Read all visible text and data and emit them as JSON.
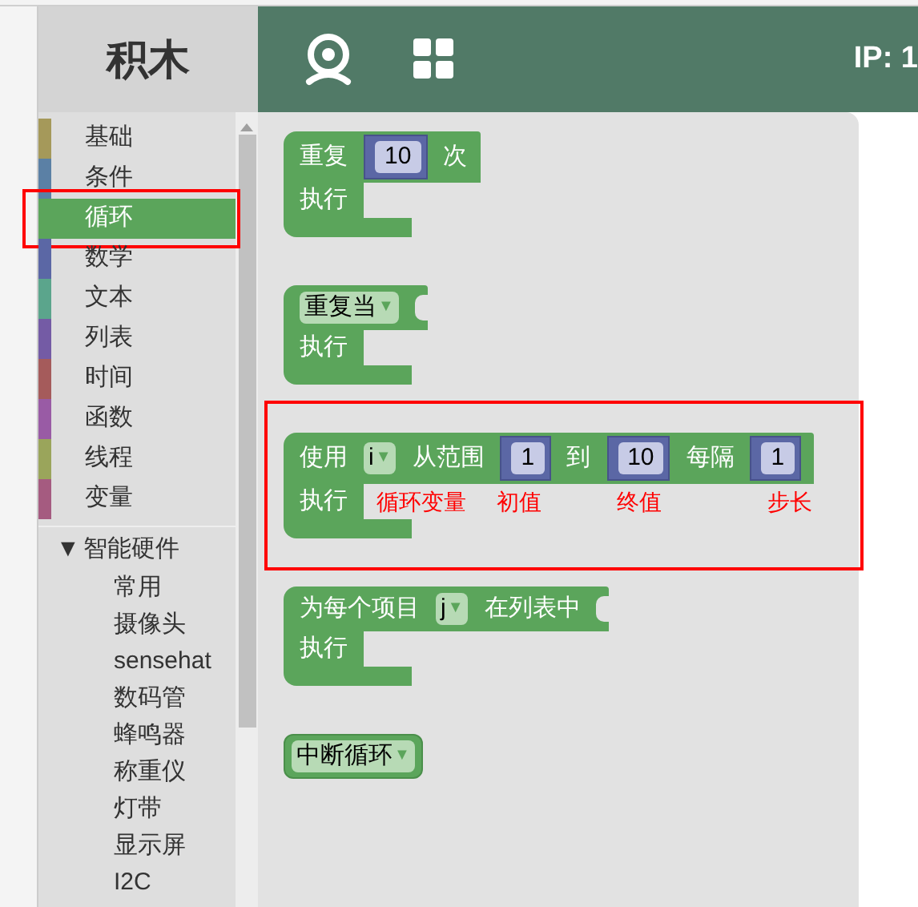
{
  "header": {
    "title": "积木",
    "ip": "IP: 1"
  },
  "categories": [
    {
      "label": "基础",
      "color": "#a5995a",
      "selected": false
    },
    {
      "label": "条件",
      "color": "#5b80a5",
      "selected": false
    },
    {
      "label": "循环",
      "color": "#5ba55b",
      "selected": true,
      "highlighted": true
    },
    {
      "label": "数学",
      "color": "#5b67a5",
      "selected": false
    },
    {
      "label": "文本",
      "color": "#5ba58c",
      "selected": false
    },
    {
      "label": "列表",
      "color": "#745ba5",
      "selected": false
    },
    {
      "label": "时间",
      "color": "#a55b5b",
      "selected": false
    },
    {
      "label": "函数",
      "color": "#995ba5",
      "selected": false
    },
    {
      "label": "线程",
      "color": "#9aa55b",
      "selected": false
    },
    {
      "label": "变量",
      "color": "#a55b80",
      "selected": false
    }
  ],
  "hardware": {
    "arrow": "▼",
    "label": "智能硬件",
    "expanded": true,
    "children": [
      {
        "label": "常用"
      },
      {
        "label": "摄像头"
      },
      {
        "label": "sensehat"
      },
      {
        "label": "数码管"
      },
      {
        "label": "蜂鸣器"
      },
      {
        "label": "称重仪"
      },
      {
        "label": "灯带"
      },
      {
        "label": "显示屏"
      },
      {
        "label": "I2C"
      }
    ]
  },
  "blocks": [
    {
      "kind": "loop",
      "top": [
        {
          "kind": "text",
          "text": "重复"
        },
        {
          "kind": "number",
          "text": "10"
        },
        {
          "kind": "text",
          "text": "次"
        }
      ],
      "body": "执行"
    },
    {
      "kind": "loop",
      "top": [
        {
          "kind": "dropdown",
          "text": "重复当"
        },
        {
          "kind": "socket"
        }
      ],
      "body": "执行"
    },
    {
      "kind": "loop",
      "highlighted": true,
      "top": [
        {
          "kind": "text",
          "text": "使用"
        },
        {
          "kind": "dropdown",
          "text": "i"
        },
        {
          "kind": "text",
          "text": "从范围"
        },
        {
          "kind": "number",
          "text": "1"
        },
        {
          "kind": "text",
          "text": "到"
        },
        {
          "kind": "number",
          "text": "10"
        },
        {
          "kind": "text",
          "text": "每隔"
        },
        {
          "kind": "number",
          "text": "1"
        }
      ],
      "body": "执行",
      "notes": [
        "循环变量",
        "初值",
        "终值",
        "步长"
      ]
    },
    {
      "kind": "loop",
      "top": [
        {
          "kind": "text",
          "text": "为每个项目"
        },
        {
          "kind": "dropdown",
          "text": "j"
        },
        {
          "kind": "text",
          "text": "在列表中"
        },
        {
          "kind": "socket"
        }
      ],
      "body": "执行"
    },
    {
      "kind": "single",
      "top": [
        {
          "kind": "dropdown",
          "text": "中断循环"
        }
      ]
    }
  ]
}
